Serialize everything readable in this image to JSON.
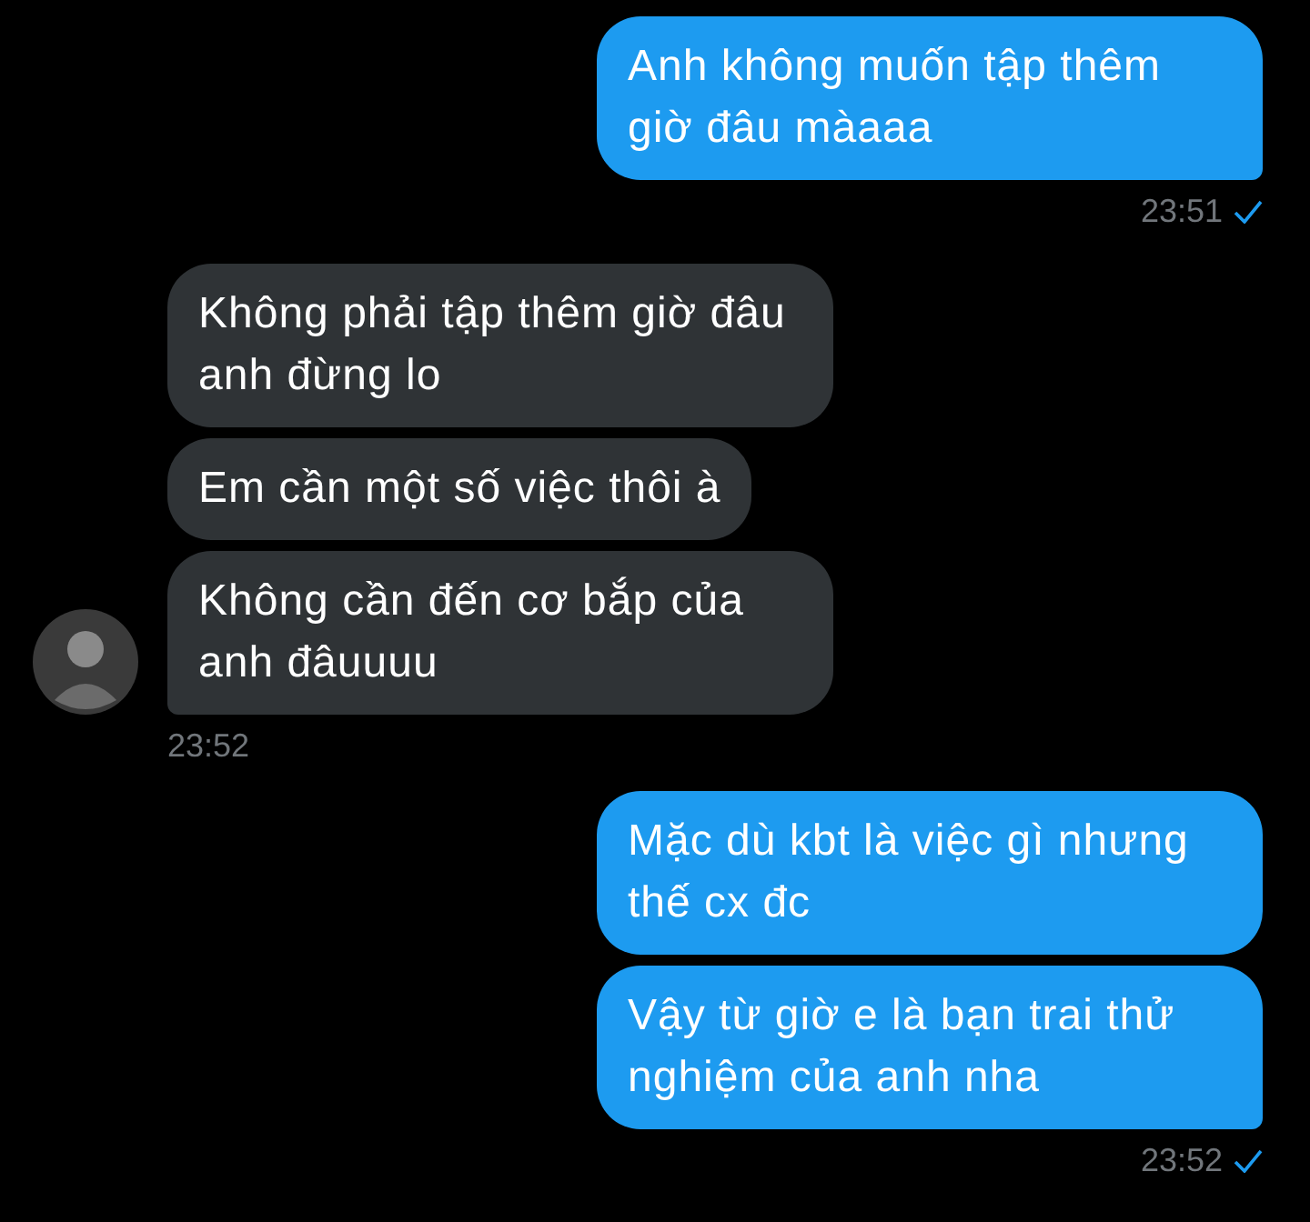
{
  "groups": [
    {
      "kind": "sent",
      "bubbles": [
        "Anh không muốn tập thêm giờ đâu màaaa"
      ],
      "time": "23:51",
      "read": true
    },
    {
      "kind": "received",
      "bubbles": [
        "Không phải tập thêm giờ đâu anh đừng lo",
        "Em cần một số việc thôi à",
        "Không cần đến cơ bắp của anh đâuuuu"
      ],
      "time": "23:52"
    },
    {
      "kind": "sent",
      "bubbles": [
        "Mặc dù kbt là việc gì nhưng thế cx đc",
        "Vậy từ giờ e là bạn trai thử nghiệm của anh nha"
      ],
      "time": "23:52",
      "read": true
    }
  ]
}
